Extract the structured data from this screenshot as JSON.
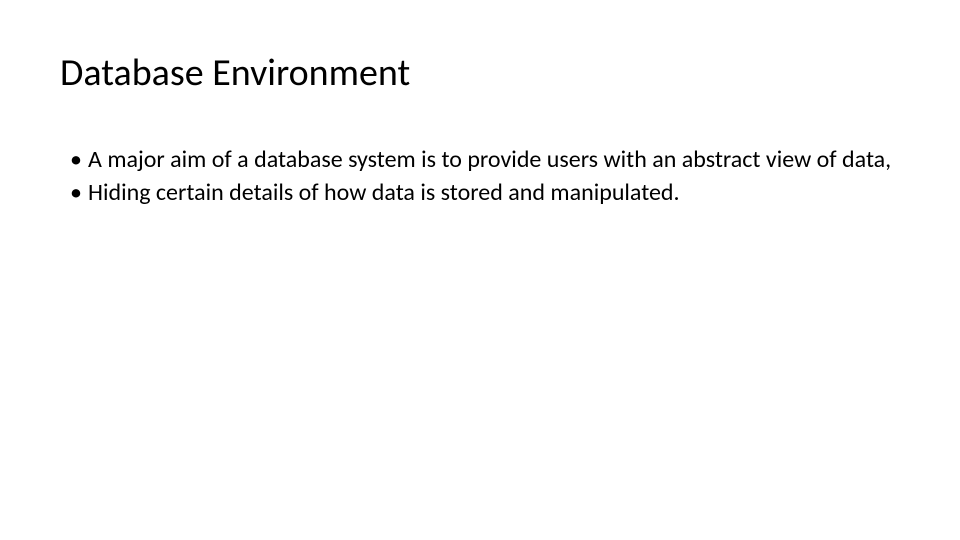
{
  "slide": {
    "title": "Database Environment",
    "bullets": [
      "A major aim of a database system is to provide users with an abstract view of data,",
      "Hiding certain details of how data is stored and manipulated."
    ]
  }
}
